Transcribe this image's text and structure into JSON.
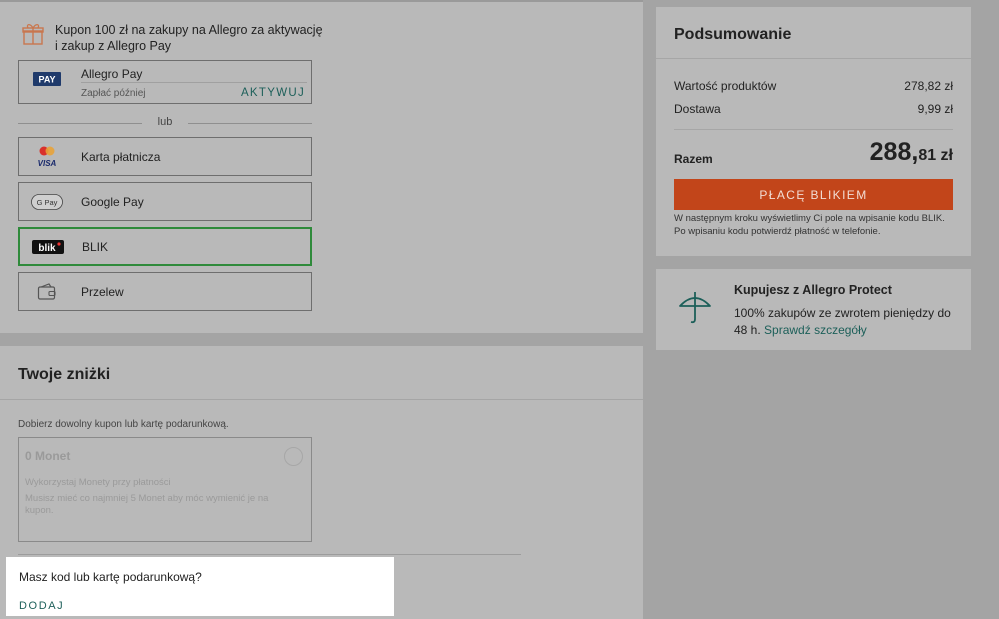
{
  "payment": {
    "promo_text_line1": "Kupon 100 zł na zakupy na Allegro za aktywację",
    "promo_text_line2": "i zakup z Allegro Pay",
    "allegro_pay": {
      "logo_text": "PAY",
      "title": "Allegro Pay",
      "subtitle": "Zapłać później",
      "action": "AKTYWUJ"
    },
    "or_label": "lub",
    "methods": [
      {
        "label": "Karta płatnicza",
        "icon": "card-icon",
        "visa_text": "VISA"
      },
      {
        "label": "Google Pay",
        "icon": "google-pay-icon",
        "logo_text": "G Pay"
      },
      {
        "label": "BLIK",
        "icon": "blik-icon",
        "logo_text": "blik",
        "selected": true
      },
      {
        "label": "Przelew",
        "icon": "wallet-icon"
      }
    ]
  },
  "discounts": {
    "title": "Twoje zniżki",
    "hint": "Dobierz dowolny kupon lub kartę podarunkową.",
    "monety_title": "0 Monet",
    "monety_line1": "Wykorzystaj Monety przy płatności",
    "monety_line2": "Musisz mieć co najmniej 5 Monet aby móc wymienić je na kupon.",
    "code_question": "Masz kod lub kartę podarunkową?",
    "add_label": "DODAJ"
  },
  "summary": {
    "title": "Podsumowanie",
    "products_label": "Wartość produktów",
    "products_value": "278,82 zł",
    "delivery_label": "Dostawa",
    "delivery_value": "9,99 zł",
    "total_label": "Razem",
    "total_main": "288,",
    "total_fraction": "81 zł",
    "pay_button": "PŁACĘ BLIKIEM",
    "note": "W następnym kroku wyświetlimy Ci pole na wpisanie kodu BLIK. Po wpisaniu kodu potwierdź płatność w telefonie."
  },
  "protect": {
    "title": "Kupujesz z Allegro Protect",
    "text": "100% zakupów ze zwrotem pieniędzy do 48 h.",
    "link": "Sprawdź szczegóły"
  },
  "colors": {
    "accent": "#c2451a",
    "link": "#1c5f59",
    "selected_border": "#2f8a3b"
  }
}
